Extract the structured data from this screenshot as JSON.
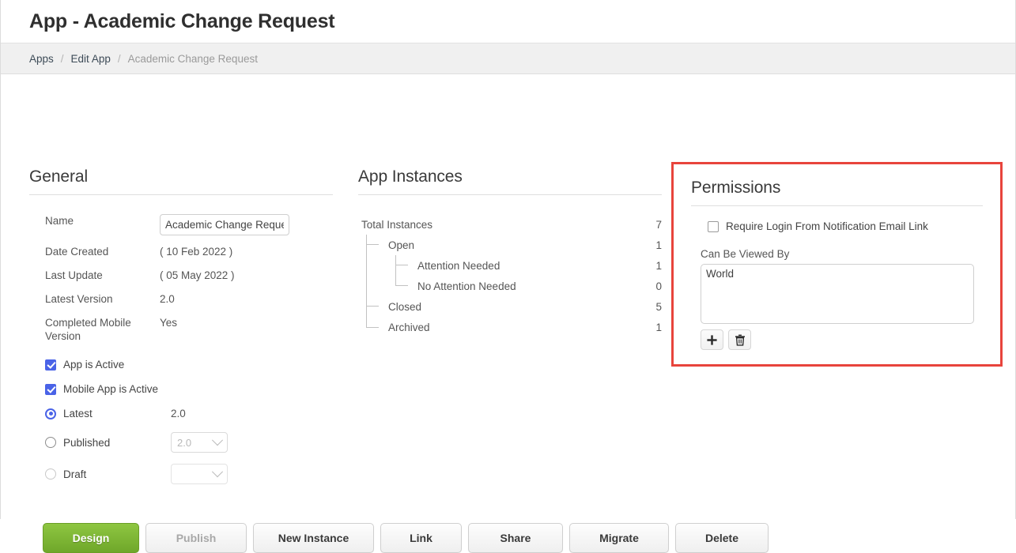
{
  "header": {
    "title": "App - Academic Change Request"
  },
  "breadcrumb": {
    "items": [
      {
        "label": "Apps",
        "current": false
      },
      {
        "label": "Edit App",
        "current": false
      },
      {
        "label": "Academic Change Request",
        "current": true
      }
    ],
    "separator": "/"
  },
  "general": {
    "title": "General",
    "fields": [
      {
        "label": "Name",
        "value": "Academic Change Request",
        "type": "input"
      },
      {
        "label": "Date Created",
        "value": "( 10 Feb 2022 )",
        "type": "text"
      },
      {
        "label": "Last Update",
        "value": "( 05 May 2022 )",
        "type": "text"
      },
      {
        "label": "Latest Version",
        "value": "2.0",
        "type": "text"
      },
      {
        "label": "Completed Mobile Version",
        "value": "Yes",
        "type": "text"
      }
    ],
    "checkboxes": [
      {
        "label": "App is Active",
        "checked": true
      },
      {
        "label": "Mobile App is Active",
        "checked": true
      }
    ],
    "version_options": [
      {
        "label": "Latest",
        "selected": true,
        "value": "2.0",
        "control": "text"
      },
      {
        "label": "Published",
        "selected": false,
        "value": "2.0",
        "control": "select"
      },
      {
        "label": "Draft",
        "selected": false,
        "value": "",
        "control": "select"
      }
    ]
  },
  "instances": {
    "title": "App Instances",
    "rows": [
      {
        "label": "Total Instances",
        "count": "7",
        "level": 0
      },
      {
        "label": "Open",
        "count": "1",
        "level": 1
      },
      {
        "label": "Attention Needed",
        "count": "1",
        "level": 2
      },
      {
        "label": "No Attention Needed",
        "count": "0",
        "level": 2
      },
      {
        "label": "Closed",
        "count": "5",
        "level": 1
      },
      {
        "label": "Archived",
        "count": "1",
        "level": 1
      }
    ]
  },
  "permissions": {
    "title": "Permissions",
    "highlight_color": "#e8443c",
    "require_login": {
      "label": "Require Login From Notification Email Link",
      "checked": false
    },
    "viewers_label": "Can Be Viewed By",
    "viewers": [
      "World"
    ],
    "add_icon": "plus-icon",
    "delete_icon": "trash-icon"
  },
  "actions": {
    "buttons": [
      {
        "label": "Design",
        "style": "primary"
      },
      {
        "label": "Publish",
        "style": "disabled"
      },
      {
        "label": "New Instance",
        "style": "default"
      },
      {
        "label": "Link",
        "style": "default"
      },
      {
        "label": "Share",
        "style": "default"
      },
      {
        "label": "Migrate",
        "style": "default"
      },
      {
        "label": "Delete",
        "style": "default"
      }
    ]
  }
}
